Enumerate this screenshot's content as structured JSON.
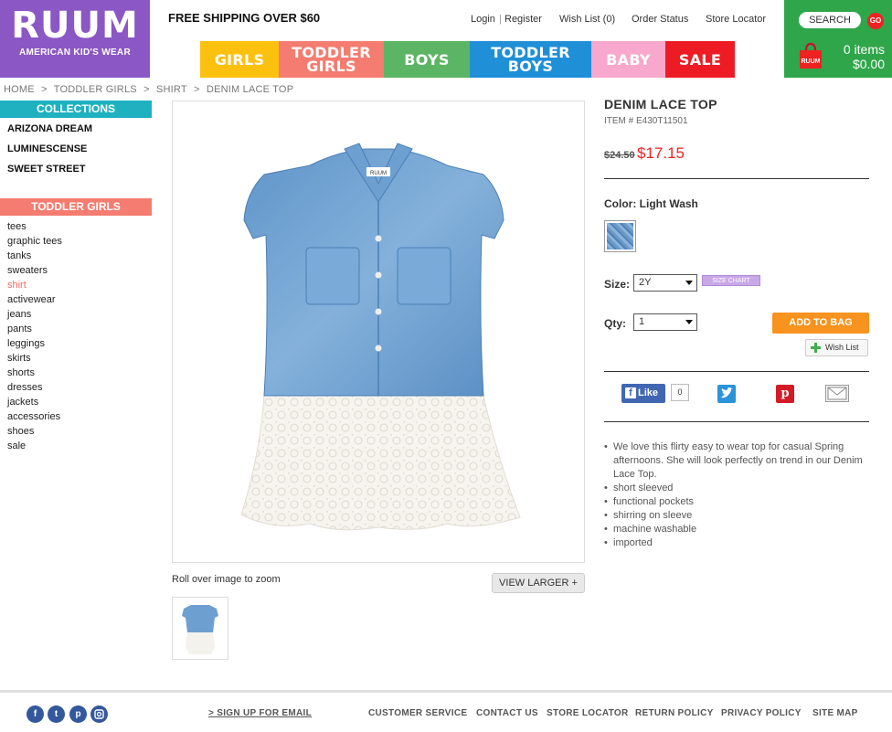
{
  "brand": {
    "name": "RUUM",
    "tagline": "AMERICAN KID'S WEAR",
    "color": "#8b57c4"
  },
  "header": {
    "free_shipping": "FREE SHIPPING OVER $60",
    "links": {
      "login": "Login",
      "separator": "|",
      "register": "Register",
      "wish_list": "Wish List (0)",
      "order_status": "Order Status",
      "store_locator": "Store Locator"
    }
  },
  "nav": [
    {
      "line1": "GIRLS",
      "line2": "",
      "color": "#fcc00f"
    },
    {
      "line1": "TODDLER",
      "line2": "GIRLS",
      "color": "#f47c70"
    },
    {
      "line1": "BOYS",
      "line2": "",
      "color": "#5cb564"
    },
    {
      "line1": "TODDLER",
      "line2": "BOYS",
      "color": "#1f8fd7"
    },
    {
      "line1": "BABY",
      "line2": "",
      "color": "#f7a8cc"
    },
    {
      "line1": "SALE",
      "line2": "",
      "color": "#ed1c24"
    }
  ],
  "cart": {
    "search_label": "SEARCH",
    "go_label": "GO",
    "items": "0 items",
    "total": "$0.00",
    "bag_logo": "RUUM",
    "color": "#2fa64a"
  },
  "breadcrumb": [
    "HOME",
    ">",
    "TODDLER GIRLS",
    ">",
    "SHIRT",
    ">",
    "DENIM LACE TOP"
  ],
  "sidebar": {
    "collections_title": "COLLECTIONS",
    "collections": [
      "ARIZONA DREAM",
      "LUMINESCENSE",
      "SWEET STREET"
    ],
    "category_title": "TODDLER GIRLS",
    "categories": [
      "tees",
      "graphic tees",
      "tanks",
      "sweaters",
      "shirt",
      "activewear",
      "jeans",
      "pants",
      "leggings",
      "skirts",
      "shorts",
      "dresses",
      "jackets",
      "accessories",
      "shoes",
      "sale"
    ],
    "active_category": "shirt"
  },
  "product": {
    "title": "DENIM LACE TOP",
    "item": "ITEM # E430T11501",
    "old_price": "$24.50",
    "price": "$17.15",
    "color_label": "Color: Light Wash",
    "size_label": "Size:",
    "size_value": "2Y",
    "size_chart": "SIZE CHART",
    "qty_label": "Qty:",
    "qty_value": "1",
    "add_to_bag": "ADD TO BAG",
    "wish_list": "Wish List",
    "like_label": "Like",
    "like_count": "0",
    "label_on_shirt": "RUUM",
    "description": [
      "We love this flirty easy to wear top for casual Spring afternoons. She will look perfectly on trend in our Denim Lace Top.",
      "short sleeved",
      "functional pockets",
      "shirring on sleeve",
      "machine washable",
      "imported"
    ]
  },
  "image": {
    "zoom_hint": "Roll over image to zoom",
    "view_larger": "VIEW LARGER +"
  },
  "footer": {
    "signup": "> SIGN UP FOR EMAIL",
    "links": [
      "CUSTOMER SERVICE",
      "CONTACT US",
      "STORE LOCATOR",
      "RETURN POLICY",
      "PRIVACY POLICY",
      "SITE MAP"
    ],
    "social": [
      "facebook-icon",
      "twitter-icon",
      "pinterest-icon",
      "instagram-icon"
    ]
  }
}
